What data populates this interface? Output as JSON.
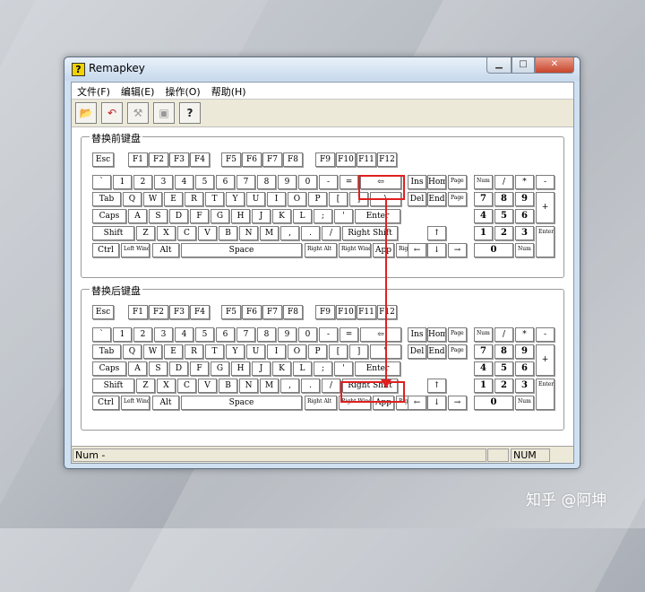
{
  "window": {
    "title": "Remapkey",
    "min": "▁",
    "max": "□",
    "close": "✕"
  },
  "menu": [
    "文件(F)",
    "编辑(E)",
    "操作(O)",
    "帮助(H)"
  ],
  "toolbar_icons": [
    "open-icon",
    "back-icon",
    "tools-icon",
    "view-icon",
    "help-icon"
  ],
  "toolbar_glyphs": [
    "📂",
    "↶",
    "⚒",
    "▣",
    "?"
  ],
  "groups": {
    "before": "替换前键盘",
    "after": "替换后键盘"
  },
  "status": {
    "text": "Num -",
    "num": "NUM"
  },
  "watermark": "知乎 @阿坤",
  "keys": {
    "esc": "Esc",
    "f": [
      "F1",
      "F2",
      "F3",
      "F4",
      "F5",
      "F6",
      "F7",
      "F8",
      "F9",
      "F10",
      "F11",
      "F12"
    ],
    "row1": [
      "`",
      "1",
      "2",
      "3",
      "4",
      "5",
      "6",
      "7",
      "8",
      "9",
      "0",
      "-",
      "=",
      "⇦"
    ],
    "row2": [
      "Tab",
      "Q",
      "W",
      "E",
      "R",
      "T",
      "Y",
      "U",
      "I",
      "O",
      "P",
      "[",
      "]",
      "\\"
    ],
    "row3": [
      "Caps",
      "A",
      "S",
      "D",
      "F",
      "G",
      "H",
      "J",
      "K",
      "L",
      ";",
      "'",
      "Enter"
    ],
    "row4": [
      "Shift",
      "Z",
      "X",
      "C",
      "V",
      "B",
      "N",
      "M",
      ",",
      ".",
      "/",
      "Right Shift"
    ],
    "row5": [
      "Ctrl",
      "Left Windows",
      "Alt",
      "Space",
      "Right Alt",
      "Right Windows",
      "App",
      "Right Ctrl"
    ],
    "nav1": [
      "Ins",
      "Home",
      "Page Up"
    ],
    "nav2": [
      "Del",
      "End",
      "Page Down"
    ],
    "arrows": [
      "↑",
      "←",
      "↓",
      "→"
    ],
    "numtop": [
      "Num Lock",
      "/",
      "*",
      "-"
    ],
    "numrows": [
      [
        "7",
        "8",
        "9"
      ],
      [
        "4",
        "5",
        "6"
      ],
      [
        "1",
        "2",
        "3"
      ]
    ],
    "numplus": "+",
    "numzero": "0",
    "numdel": "Num Del",
    "numenter": "Enter"
  },
  "colors": {
    "highlight": "#e02020"
  }
}
